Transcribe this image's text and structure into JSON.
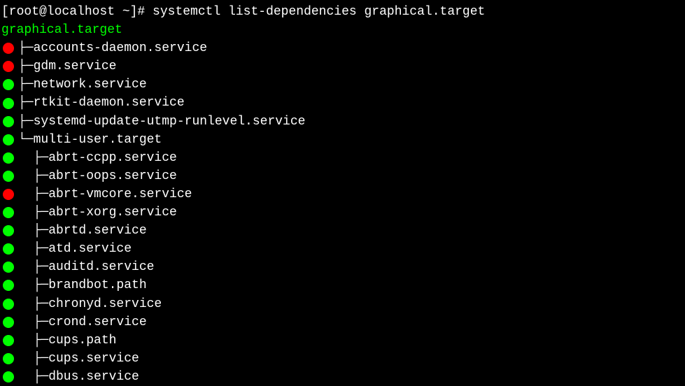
{
  "prompt": {
    "prefix": "[root@localhost ~]# ",
    "command": "systemctl list-dependencies graphical.target"
  },
  "root_target": "graphical.target",
  "deps": [
    {
      "status": "red",
      "indent": 0,
      "branch": "├─",
      "name": "accounts-daemon.service"
    },
    {
      "status": "red",
      "indent": 0,
      "branch": "├─",
      "name": "gdm.service"
    },
    {
      "status": "green",
      "indent": 0,
      "branch": "├─",
      "name": "network.service"
    },
    {
      "status": "green",
      "indent": 0,
      "branch": "├─",
      "name": "rtkit-daemon.service"
    },
    {
      "status": "green",
      "indent": 0,
      "branch": "├─",
      "name": "systemd-update-utmp-runlevel.service"
    },
    {
      "status": "green",
      "indent": 0,
      "branch": "└─",
      "name": "multi-user.target"
    },
    {
      "status": "green",
      "indent": 1,
      "branch": "├─",
      "name": "abrt-ccpp.service"
    },
    {
      "status": "green",
      "indent": 1,
      "branch": "├─",
      "name": "abrt-oops.service"
    },
    {
      "status": "red",
      "indent": 1,
      "branch": "├─",
      "name": "abrt-vmcore.service"
    },
    {
      "status": "green",
      "indent": 1,
      "branch": "├─",
      "name": "abrt-xorg.service"
    },
    {
      "status": "green",
      "indent": 1,
      "branch": "├─",
      "name": "abrtd.service"
    },
    {
      "status": "green",
      "indent": 1,
      "branch": "├─",
      "name": "atd.service"
    },
    {
      "status": "green",
      "indent": 1,
      "branch": "├─",
      "name": "auditd.service"
    },
    {
      "status": "green",
      "indent": 1,
      "branch": "├─",
      "name": "brandbot.path"
    },
    {
      "status": "green",
      "indent": 1,
      "branch": "├─",
      "name": "chronyd.service"
    },
    {
      "status": "green",
      "indent": 1,
      "branch": "├─",
      "name": "crond.service"
    },
    {
      "status": "green",
      "indent": 1,
      "branch": "├─",
      "name": "cups.path"
    },
    {
      "status": "green",
      "indent": 1,
      "branch": "├─",
      "name": "cups.service"
    },
    {
      "status": "green",
      "indent": 1,
      "branch": "├─",
      "name": "dbus.service"
    }
  ]
}
